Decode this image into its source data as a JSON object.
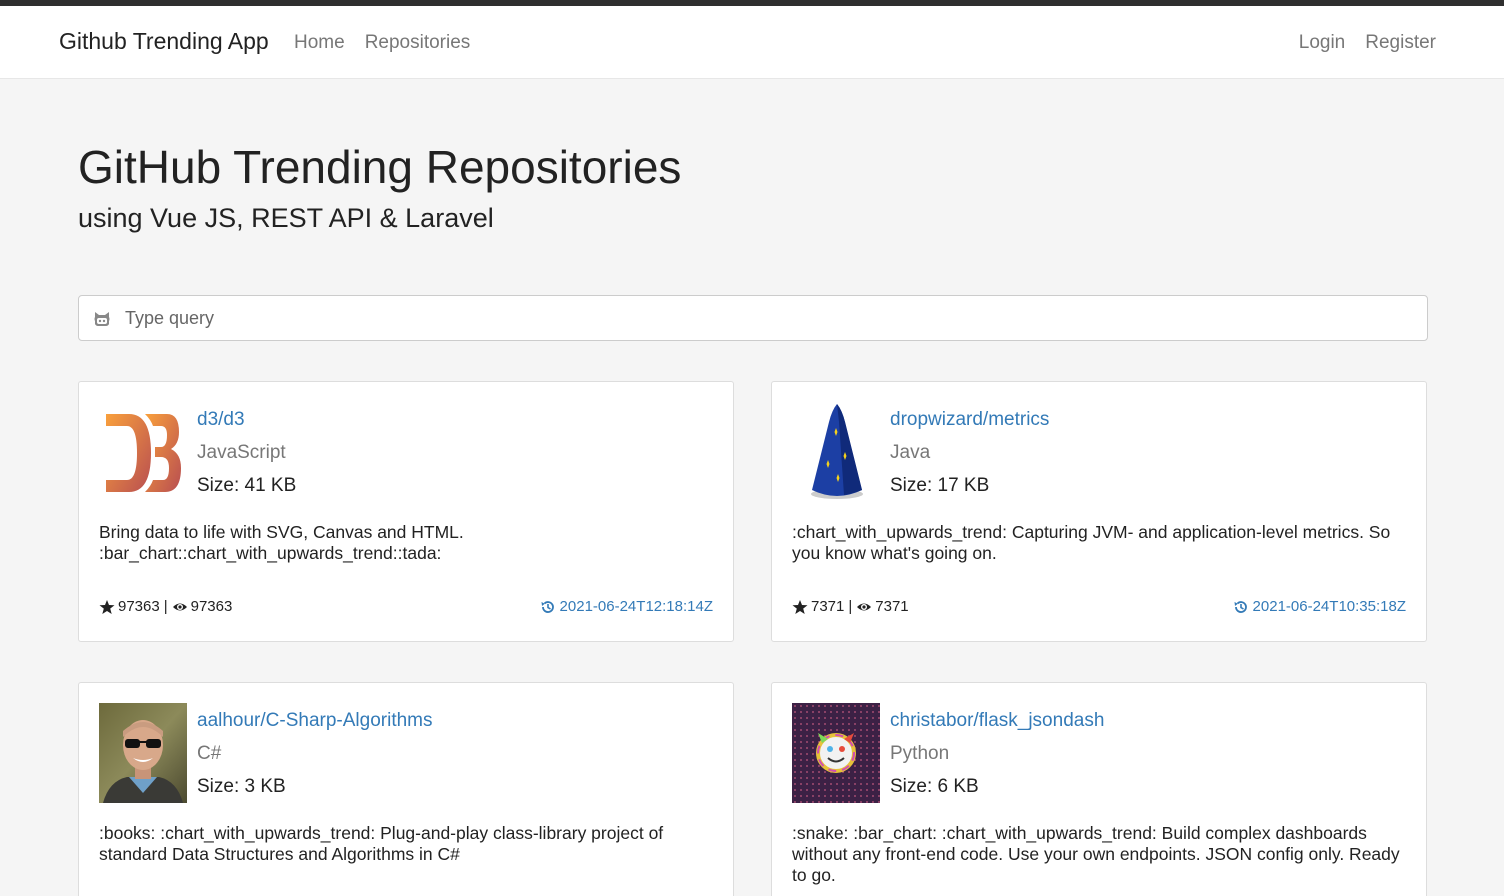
{
  "navbar": {
    "brand": "Github Trending App",
    "left_links": [
      "Home",
      "Repositories"
    ],
    "right_links": [
      "Login",
      "Register"
    ]
  },
  "hero": {
    "title": "GitHub Trending Repositories",
    "subtitle": "using Vue JS, REST API & Laravel"
  },
  "search": {
    "placeholder": "Type query",
    "icon": "github-icon"
  },
  "repos": [
    {
      "name": "d3/d3",
      "language": "JavaScript",
      "size": "Size: 41 KB",
      "description": "Bring data to life with SVG, Canvas and HTML. :bar_chart::chart_with_upwards_trend::tada:",
      "stars": "97363",
      "watchers": "97363",
      "updated": "2021-06-24T12:18:14Z",
      "avatar": "d3-logo"
    },
    {
      "name": "dropwizard/metrics",
      "language": "Java",
      "size": "Size: 17 KB",
      "description": ":chart_with_upwards_trend: Capturing JVM- and application-level metrics. So you know what's going on.",
      "stars": "7371",
      "watchers": "7371",
      "updated": "2021-06-24T10:35:18Z",
      "avatar": "wizard-hat-logo"
    },
    {
      "name": "aalhour/C-Sharp-Algorithms",
      "language": "C#",
      "size": "Size: 3 KB",
      "description": ":books: :chart_with_upwards_trend: Plug-and-play class-library project of standard Data Structures and Algorithms in C#",
      "stars": "",
      "watchers": "",
      "updated": "",
      "avatar": "user-photo"
    },
    {
      "name": "christabor/flask_jsondash",
      "language": "Python",
      "size": "Size: 6 KB",
      "description": ":snake: :bar_chart: :chart_with_upwards_trend: Build complex dashboards without any front-end code. Use your own endpoints. JSON config only. Ready to go.",
      "stars": "",
      "watchers": "",
      "updated": "",
      "avatar": "user-avatar-pattern"
    }
  ],
  "colors": {
    "link": "#337ab7",
    "muted": "#777777",
    "background": "#f5f5f5"
  }
}
